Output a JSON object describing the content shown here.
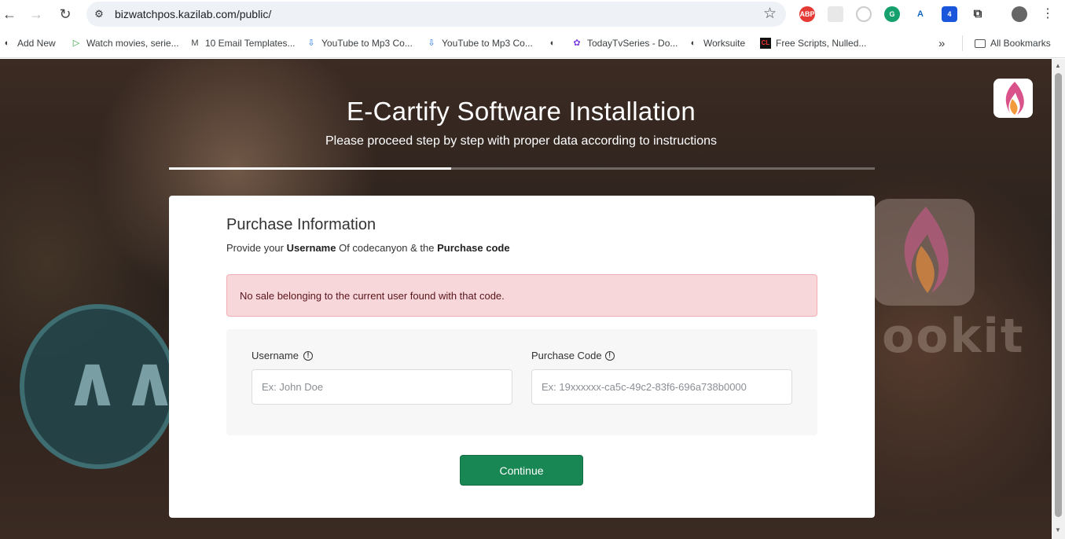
{
  "browser": {
    "url": "bizwatchpos.kazilab.com/public/",
    "extensions": [
      {
        "name": "abp-icon",
        "label": "ABP",
        "color": "#e53935"
      },
      {
        "name": "grammarly-icon",
        "label": "G",
        "color": "#15a06e"
      },
      {
        "name": "translator-icon",
        "label": "A",
        "color": "#1565c0"
      },
      {
        "name": "badge-extension-icon",
        "label": "4",
        "color": "#1a56db"
      }
    ],
    "bookmarks": [
      {
        "label": "Add New",
        "icon": "globe-icon"
      },
      {
        "label": "Watch movies, serie...",
        "icon": "play-icon"
      },
      {
        "label": "10 Email Templates...",
        "icon": "m-logo-icon"
      },
      {
        "label": "YouTube to Mp3 Co...",
        "icon": "download-icon"
      },
      {
        "label": "YouTube to Mp3 Co...",
        "icon": "download-icon"
      },
      {
        "label": "",
        "icon": "globe-icon"
      },
      {
        "label": "TodayTvSeries - Do...",
        "icon": "tv-icon"
      },
      {
        "label": "Worksuite",
        "icon": "globe-icon"
      },
      {
        "label": "Free Scripts, Nulled...",
        "icon": "cl-logo-icon"
      }
    ],
    "all_bookmarks_label": "All Bookmarks",
    "more_bookmarks_label": "»"
  },
  "page": {
    "title": "E-Cartify Software Installation",
    "subtitle": "Please proceed step by step with proper data according to instructions",
    "progress_fraction": 0.4,
    "card": {
      "title": "Purchase Information",
      "desc_prefix": "Provide your ",
      "desc_username": "Username",
      "desc_middle": " Of codecanyon & the ",
      "desc_code": "Purchase code",
      "alert": "No sale belonging to the current user found with that code.",
      "username_label": "Username",
      "username_placeholder": "Ex: John Doe",
      "code_label": "Purchase Code",
      "code_placeholder": "Ex: 19xxxxxx-ca5c-49c2-83f6-696a738b0000",
      "continue_label": "Continue"
    },
    "accent_color": "#198754",
    "alert_color": "#f8d7da"
  }
}
